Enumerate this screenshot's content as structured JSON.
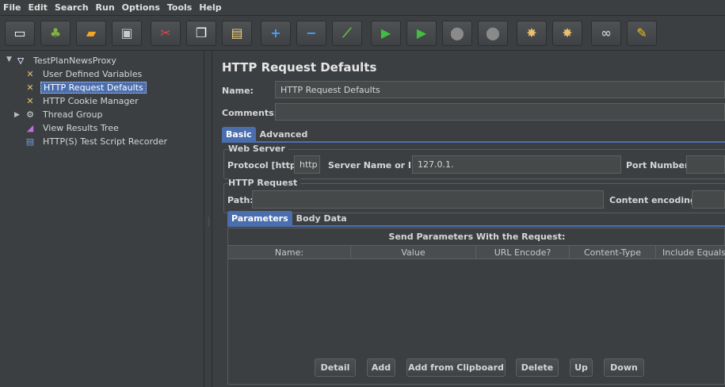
{
  "menubar": {
    "items": [
      "File",
      "Edit",
      "Search",
      "Run",
      "Options",
      "Tools",
      "Help"
    ]
  },
  "toolbar": {
    "buttons": [
      {
        "name": "new-icon",
        "glyph": "▭",
        "color": "#ffffff"
      },
      {
        "name": "templates-icon",
        "glyph": "♣",
        "color": "#7fb342"
      },
      {
        "name": "open-icon",
        "glyph": "▰",
        "color": "#f5a623"
      },
      {
        "name": "save-icon",
        "glyph": "▣",
        "color": "#c8c8c8"
      },
      {
        "name": "cut-icon",
        "glyph": "✂",
        "color": "#e04848"
      },
      {
        "name": "copy-icon",
        "glyph": "❐",
        "color": "#ffffff"
      },
      {
        "name": "paste-icon",
        "glyph": "▤",
        "color": "#f0d080"
      },
      {
        "name": "expand-icon",
        "glyph": "+",
        "color": "#4a9df5"
      },
      {
        "name": "collapse-icon",
        "glyph": "−",
        "color": "#4a9df5"
      },
      {
        "name": "toggle-icon",
        "glyph": "⟋",
        "color": "#6cc04a"
      },
      {
        "name": "start-icon",
        "glyph": "▶",
        "color": "#3fbf3f"
      },
      {
        "name": "start-no-pauses-icon",
        "glyph": "▶",
        "color": "#3fbf3f"
      },
      {
        "name": "stop-icon",
        "glyph": "⬤",
        "color": "#8a8a8a"
      },
      {
        "name": "shutdown-icon",
        "glyph": "⬤",
        "color": "#8a8a8a"
      },
      {
        "name": "clear-icon",
        "glyph": "✸",
        "color": "#e8c070"
      },
      {
        "name": "clear-all-icon",
        "glyph": "✸",
        "color": "#e8c070"
      },
      {
        "name": "search-icon",
        "glyph": "∞",
        "color": "#c0c0c0"
      },
      {
        "name": "reset-search-icon",
        "glyph": "✎",
        "color": "#f0c020"
      }
    ]
  },
  "tree": {
    "root": "TestPlanNewsProxy",
    "items": [
      {
        "label": "User Defined Variables",
        "icon": "scissors-tool-icon"
      },
      {
        "label": "HTTP Request Defaults",
        "icon": "scissors-tool-icon",
        "selected": true
      },
      {
        "label": "HTTP Cookie Manager",
        "icon": "scissors-tool-icon"
      },
      {
        "label": "Thread Group",
        "icon": "gear-icon"
      },
      {
        "label": "View Results Tree",
        "icon": "chart-icon"
      },
      {
        "label": "HTTP(S) Test Script Recorder",
        "icon": "recorder-icon"
      }
    ]
  },
  "panel": {
    "title": "HTTP Request Defaults",
    "name_label": "Name:",
    "name_value": "HTTP Request Defaults",
    "comments_label": "Comments:",
    "tabs": [
      "Basic",
      "Advanced"
    ],
    "web_server": {
      "title": "Web Server",
      "protocol_label": "Protocol [http]:",
      "protocol_value": "http",
      "server_label": "Server Name or IP:",
      "server_value": "127.0.1.",
      "port_label": "Port Number:"
    },
    "http_request": {
      "title": "HTTP Request",
      "path_label": "Path:",
      "encoding_label": "Content encoding:"
    },
    "sub_tabs": [
      "Parameters",
      "Body Data"
    ],
    "params_caption": "Send Parameters With the Request:",
    "columns": [
      "Name:",
      "Value",
      "URL Encode?",
      "Content-Type",
      "Include Equals?"
    ],
    "buttons": [
      "Detail",
      "Add",
      "Add from Clipboard",
      "Delete",
      "Up",
      "Down"
    ]
  }
}
